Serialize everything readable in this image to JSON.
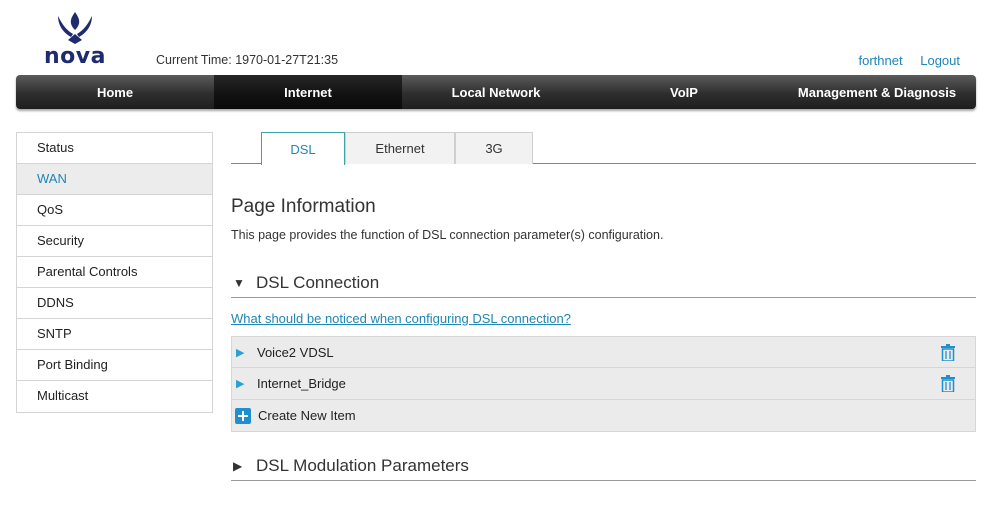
{
  "brand": {
    "logo_text": "nova",
    "color": "#1e2b6e"
  },
  "header": {
    "current_time_label": "Current Time:",
    "current_time_value": "1970-01-27T21:35",
    "user": "forthnet",
    "logout": "Logout"
  },
  "nav": {
    "items": [
      "Home",
      "Internet",
      "Local Network",
      "VoIP",
      "Management & Diagnosis"
    ],
    "active": "Internet"
  },
  "sidebar": {
    "items": [
      "Status",
      "WAN",
      "QoS",
      "Security",
      "Parental Controls",
      "DDNS",
      "SNTP",
      "Port Binding",
      "Multicast"
    ],
    "active": "WAN"
  },
  "tabs": {
    "items": [
      "DSL",
      "Ethernet",
      "3G"
    ],
    "active": "DSL"
  },
  "page": {
    "title": "Page Information",
    "description": "This page provides the function of DSL connection parameter(s) configuration."
  },
  "dsl_connection": {
    "title": "DSL Connection",
    "expanded_icon": "triangle-down",
    "notice_link": "What should be noticed when configuring DSL connection?",
    "connections": [
      "Voice2 VDSL",
      "Internet_Bridge"
    ],
    "create_label": "Create New Item"
  },
  "dsl_modulation": {
    "title": "DSL Modulation Parameters",
    "collapsed_icon": "triangle-right"
  },
  "colors": {
    "accent": "#1f86b6",
    "tab_border": "#3fa3a9",
    "nav_bg": "#2e2e2e"
  }
}
